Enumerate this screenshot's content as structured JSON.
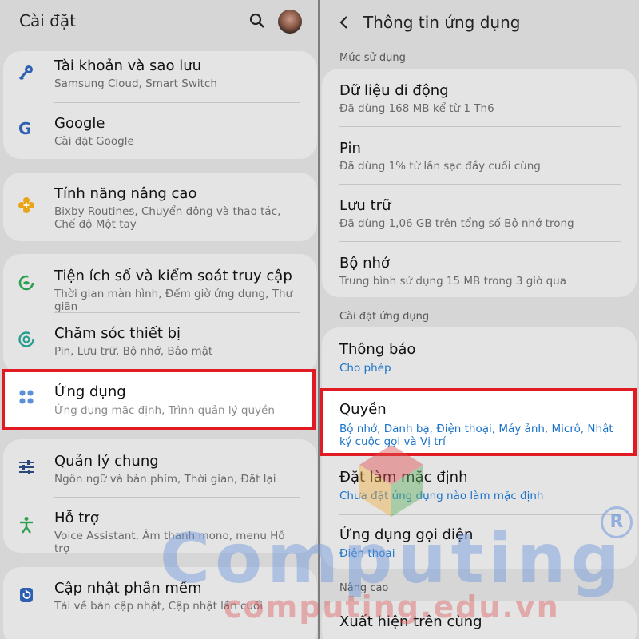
{
  "left": {
    "title": "Cài đặt",
    "items": [
      {
        "title": "Tài khoản và sao lưu",
        "subtitle": "Samsung Cloud, Smart Switch"
      },
      {
        "title": "Google",
        "subtitle": "Cài đặt Google"
      },
      {
        "title": "Tính năng nâng cao",
        "subtitle": "Bixby Routines, Chuyển động và thao tác, Chế độ Một tay"
      },
      {
        "title": "Tiện ích số và kiểm soát truy cập",
        "subtitle": "Thời gian màn hình, Đếm giờ ứng dụng, Thư giãn"
      },
      {
        "title": "Chăm sóc thiết bị",
        "subtitle": "Pin, Lưu trữ, Bộ nhớ, Bảo mật"
      },
      {
        "title": "Ứng dụng",
        "subtitle": "Ứng dụng mặc định, Trình quản lý quyền"
      },
      {
        "title": "Quản lý chung",
        "subtitle": "Ngôn ngữ và bàn phím, Thời gian, Đặt lại"
      },
      {
        "title": "Hỗ trợ",
        "subtitle": "Voice Assistant, Âm thanh mono, menu Hỗ trợ"
      },
      {
        "title": "Cập nhật phần mềm",
        "subtitle": "Tải về bản cập nhật, Cập nhật lần cuối"
      }
    ]
  },
  "right": {
    "title": "Thông tin ứng dụng",
    "sections": {
      "usage": "Mức sử dụng",
      "app_settings": "Cài đặt ứng dụng",
      "advanced": "Nâng cao"
    },
    "usage_items": [
      {
        "title": "Dữ liệu di động",
        "subtitle": "Đã dùng 168 MB kể từ 1 Th6"
      },
      {
        "title": "Pin",
        "subtitle": "Đã dùng 1% từ lần sạc đầy cuối cùng"
      },
      {
        "title": "Lưu trữ",
        "subtitle": "Đã dùng 1,06 GB trên tổng số Bộ nhớ trong"
      },
      {
        "title": "Bộ nhớ",
        "subtitle": "Trung bình sử dụng 15 MB trong 3 giờ qua"
      }
    ],
    "settings_items": [
      {
        "title": "Thông báo",
        "subtitle": "Cho phép"
      },
      {
        "title": "Quyền",
        "subtitle": "Bộ nhớ, Danh bạ, Điện thoại, Máy ảnh, Micrô, Nhật ký cuộc gọi và Vị trí"
      },
      {
        "title": "Đặt làm mặc định",
        "subtitle": "Chưa đặt ứng dụng nào làm mặc định"
      },
      {
        "title": "Ứng dụng gọi điện",
        "subtitle": "Điện thoại"
      }
    ],
    "advanced_items": [
      {
        "title": "Xuất hiện trên cùng"
      }
    ]
  },
  "watermark": {
    "brand": "Computing",
    "site": "computing.edu.vn",
    "mark": "R"
  },
  "colors": {
    "highlight": "#e01b24",
    "link": "#1a73c9"
  }
}
